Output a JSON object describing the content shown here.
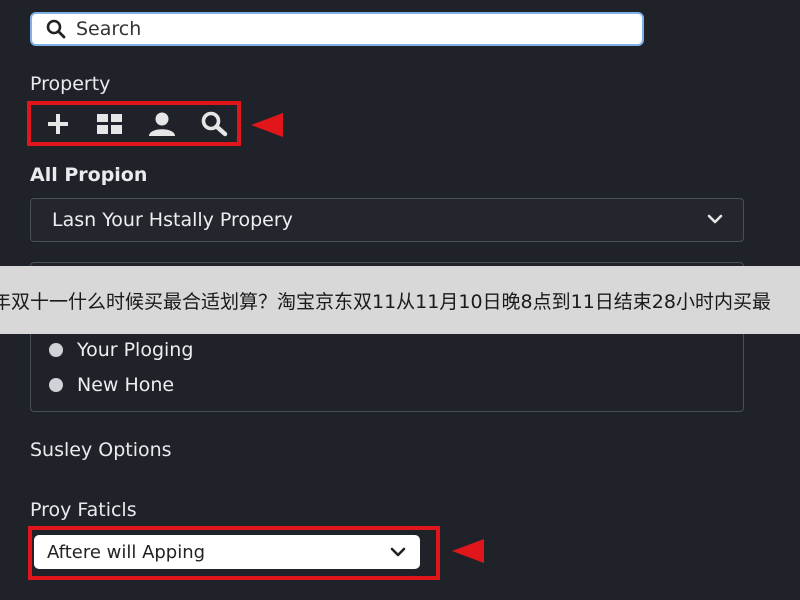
{
  "search": {
    "placeholder": "Search",
    "icon": "search-icon"
  },
  "property": {
    "heading": "Property",
    "toolbar": {
      "icons": [
        "plus-icon",
        "grid-icon",
        "user-icon",
        "search-icon"
      ],
      "highlight_color": "#e0161b"
    }
  },
  "all_propion": {
    "heading": "All Propion",
    "selected": "Lasn Your Hstally Propery"
  },
  "radio_group": {
    "options": [
      "Your Ploging",
      "New Hone"
    ]
  },
  "banner": {
    "text": "年双十一什么时候买最合适划算？淘宝京东双11从11月10日晚8点到11日结束28小时内买最"
  },
  "susley_options": {
    "heading": "Susley Options"
  },
  "proy_faticls": {
    "heading": "Proy Faticls",
    "selected": "Aftere will Apping"
  },
  "colors": {
    "background": "#1f2228",
    "accent_red": "#e0161b",
    "search_border": "#7fb0e8"
  }
}
